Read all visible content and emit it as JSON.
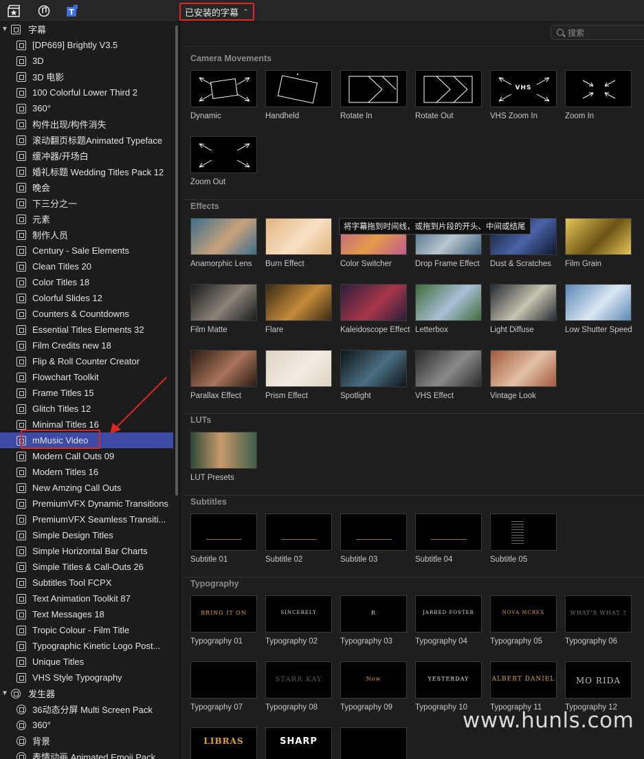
{
  "topbar": {
    "title": "已安装的字幕"
  },
  "search": {
    "placeholder": "搜索"
  },
  "sidebar": {
    "titles_header": "字幕",
    "titles": [
      "[DP669] Brightly V3.5",
      "3D",
      "3D 电影",
      "100 Colorful Lower Third 2",
      "360°",
      "构件出现/构件消失",
      "滚动翻页标题Animated Typeface",
      "缓冲器/开场白",
      "婚礼标题 Wedding Titles Pack 12",
      "晚会",
      "下三分之一",
      "元素",
      "制作人员",
      "Century - Sale Elements",
      "Clean Titles 20",
      "Color Titles 18",
      "Colorful Slides 12",
      "Counters & Countdowns",
      "Essential Titles Elements 32",
      "Film Credits new 18",
      "Flip & Roll Counter Creator",
      "Flowchart Toolkit",
      "Frame Titles 15",
      "Glitch Titles 12",
      "Minimal Titles 16",
      "mMusic Video",
      "Modern Call Outs 09",
      "Modern Titles 16",
      "New Amzing Call Outs",
      "PremiumVFX Dynamic Transitions",
      "PremiumVFX Seamless Transiti...",
      "Simple Design Titles",
      "Simple Horizontal Bar Charts",
      "Simple Titles & Call-Outs 26",
      "Subtitles Tool FCPX",
      "Text Animation Toolkit 87",
      "Text Messages 18",
      "Tropic Colour - Film Title",
      "Typographic Kinetic Logo Post...",
      "Unique Titles",
      "VHS Style Typography"
    ],
    "selected_index": 25,
    "generators_header": "发生器",
    "generators": [
      "36动态分屏 Multi Screen Pack",
      "360°",
      "背景",
      "表情动画 Animated Emoji Pack..."
    ]
  },
  "sections": {
    "camera": {
      "title": "Camera Movements",
      "items": [
        "Dynamic",
        "Handheld",
        "Rotate In",
        "Rotate Out",
        "VHS Zoom In",
        "Zoom In",
        "Zoom Out"
      ]
    },
    "effects": {
      "title": "Effects",
      "items": [
        "Anamorphic Lens",
        "Burn Effect",
        "Color Switcher",
        "Drop Frame Effect",
        "Dust & Scratches",
        "Film Grain",
        "Film Matte",
        "Flare",
        "Kaleidoscope Effect",
        "Letterbox",
        "Light Diffuse",
        "Low Shutter Speed",
        "Parallax Effect",
        "Prism Effect",
        "Spotlight",
        "VHS Effect",
        "Vintage Look"
      ]
    },
    "luts": {
      "title": "LUTs",
      "items": [
        "LUT Presets"
      ]
    },
    "subtitles": {
      "title": "Subtitles",
      "items": [
        "Subtitle 01",
        "Subtitle 02",
        "Subtitle 03",
        "Subtitle 04",
        "Subtitle 05"
      ]
    },
    "typography": {
      "title": "Typography",
      "items": [
        "Typography 01",
        "Typography 02",
        "Typography 03",
        "Typography 04",
        "Typography 05",
        "Typography 06",
        "Typography 07",
        "Typography 08",
        "Typography 09",
        "Typography 10",
        "Typography 11",
        "Typography 12"
      ]
    }
  },
  "thumb_text": {
    "vhs": "VHS",
    "t01": "BRING IT ON",
    "t02": "SINCERELY",
    "t03": "R",
    "t04": "JARRED FOSTER",
    "t05": "NOVA MCREX",
    "t06": "WHAT'S WHAT ?",
    "t07": "",
    "t08": "STARR KAY",
    "t09": "Now",
    "t10": "YESTERDAY",
    "t11": "ALBERT DANIEL",
    "t12": "MO RIDA",
    "t13": "LIBRAS",
    "t14": "SHARP"
  },
  "tooltip": "将字幕拖到时间线，或拖到片段的开头、中间或结尾",
  "watermark": "www.hunls.com",
  "colors": {
    "selection": "#3d4aa6",
    "highlight_box": "#e0261c",
    "background": "#1e1e1f"
  }
}
